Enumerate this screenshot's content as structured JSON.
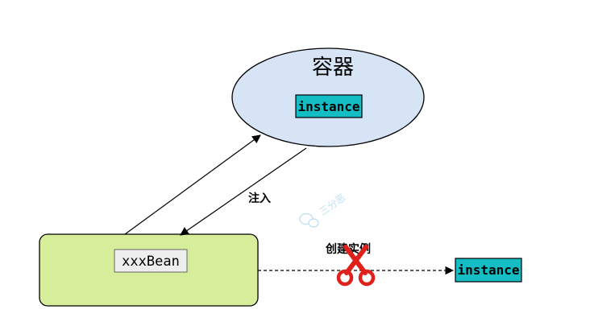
{
  "container": {
    "title": "容器",
    "instance_label": "instance"
  },
  "bean": {
    "label": "xxxBean"
  },
  "arrows": {
    "inject_label": "注入",
    "create_label": "创建实例"
  },
  "external_instance": {
    "label": "instance"
  },
  "watermark": {
    "text": "三分恶",
    "icon": "wechat-icon"
  },
  "colors": {
    "container_fill": "#d6e4f5",
    "bean_fill": "#d6ee9a",
    "instance_fill": "#14bcc4",
    "label_fill": "#eeeeee",
    "scissors": "#e0201b",
    "watermark": "#b7dcef"
  }
}
